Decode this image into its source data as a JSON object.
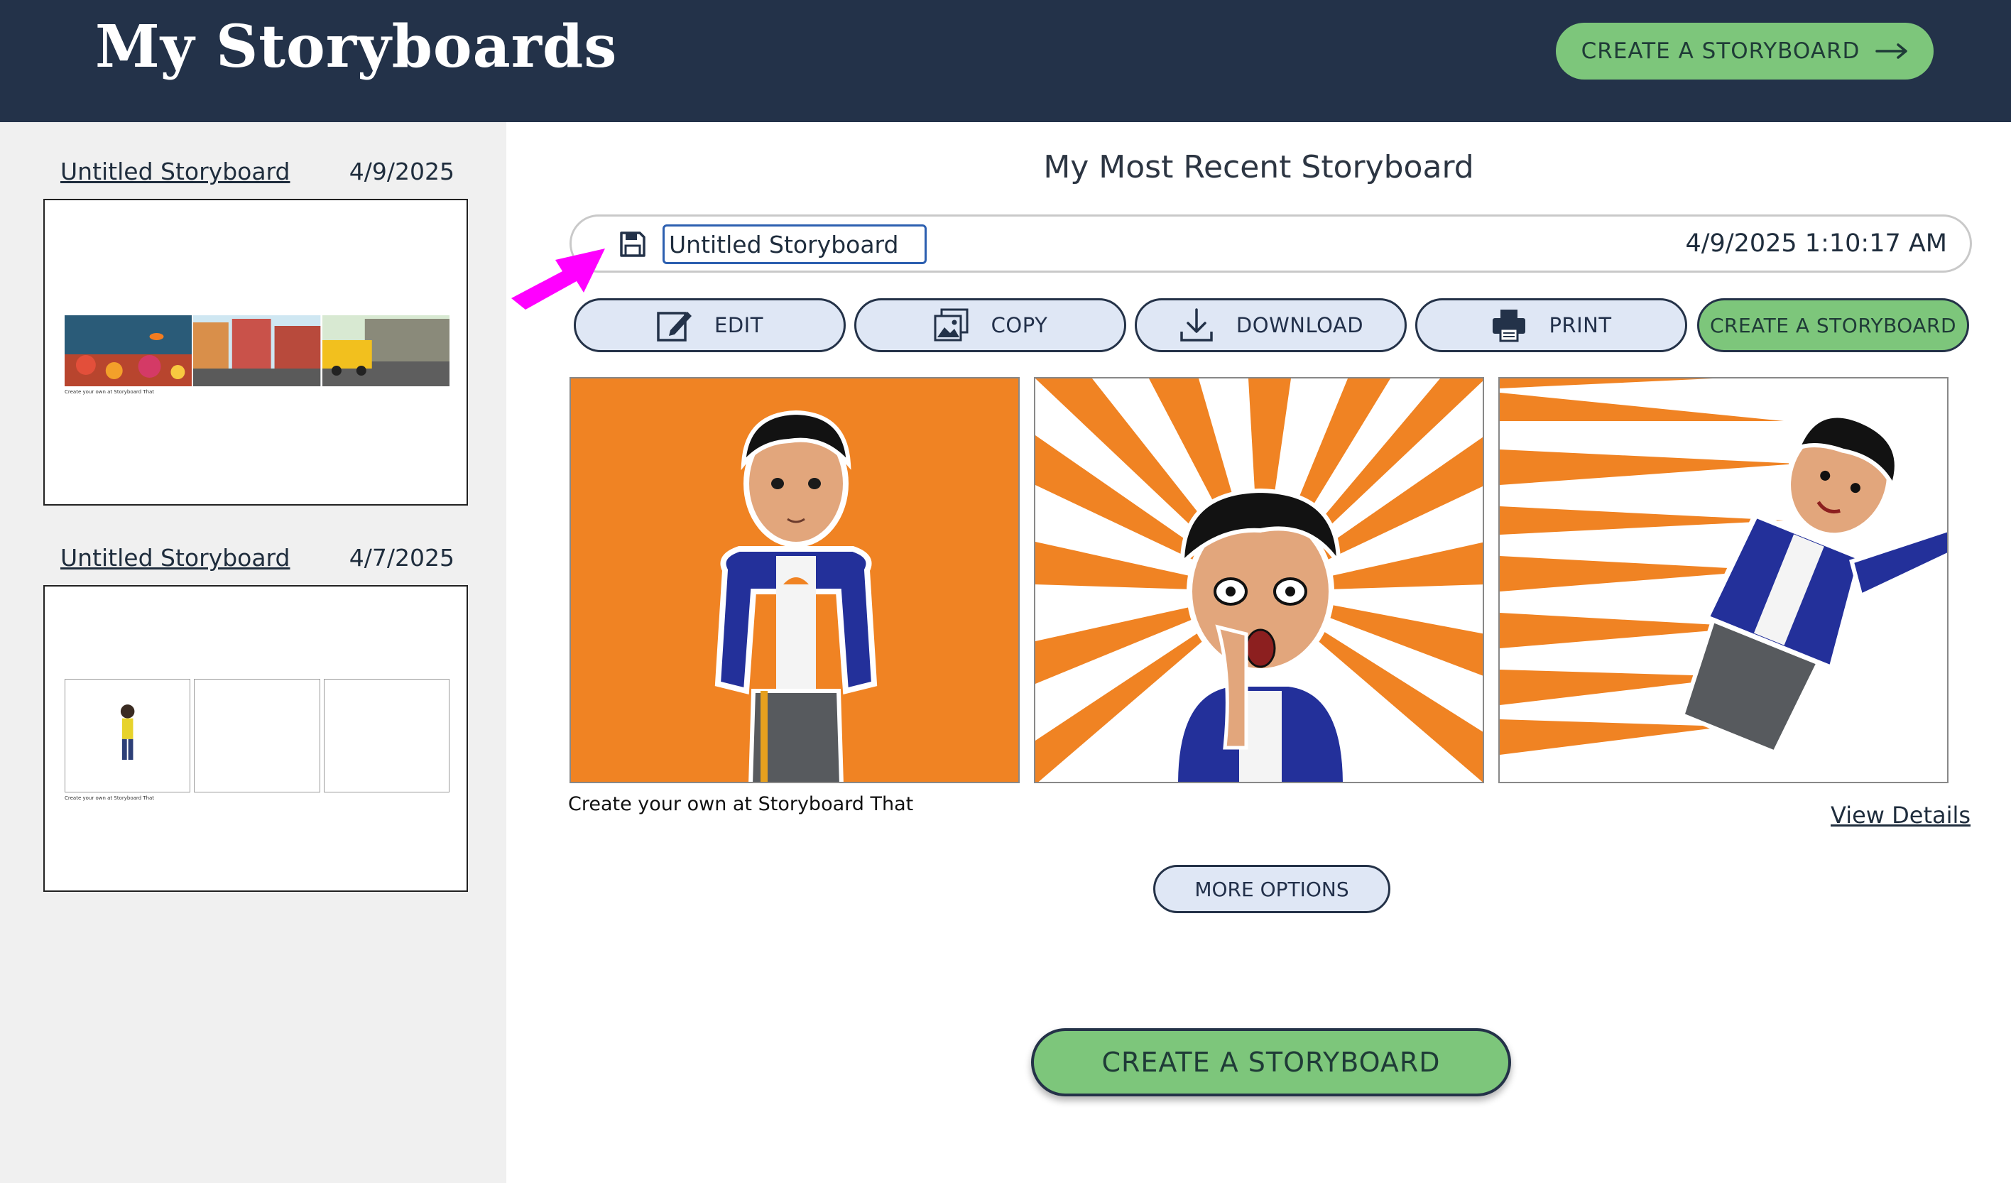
{
  "header": {
    "title": "My Storyboards",
    "cta_label": "CREATE A STORYBOARD"
  },
  "sidebar": {
    "items": [
      {
        "title": "Untitled Storyboard",
        "date": "4/9/2025",
        "thumb_caption": "Create your own at Storyboard That"
      },
      {
        "title": "Untitled Storyboard",
        "date": "4/7/2025",
        "thumb_caption": "Create your own at Storyboard That"
      }
    ]
  },
  "main": {
    "section_title": "My Most Recent Storyboard",
    "storyboard_title_value": "Untitled Storyboard",
    "timestamp": "4/9/2025 1:10:17 AM",
    "actions": {
      "edit": "EDIT",
      "copy": "COPY",
      "download": "DOWNLOAD",
      "print": "PRINT",
      "create": "CREATE A STORYBOARD"
    },
    "caption": "Create your own at Storyboard That",
    "view_details": "View Details",
    "more_options": "MORE OPTIONS",
    "bottom_cta": "CREATE A STORYBOARD"
  },
  "colors": {
    "header_bg": "#233249",
    "cta_green": "#7dc67b",
    "button_bg": "#dfe7f5",
    "panel_orange": "#f08323",
    "annotation_arrow": "#ff00ff"
  },
  "icons": {
    "save": "floppy-disk-icon",
    "edit": "pencil-square-icon",
    "copy": "image-copy-icon",
    "download": "download-icon",
    "print": "printer-icon",
    "arrow": "arrow-right-icon"
  }
}
